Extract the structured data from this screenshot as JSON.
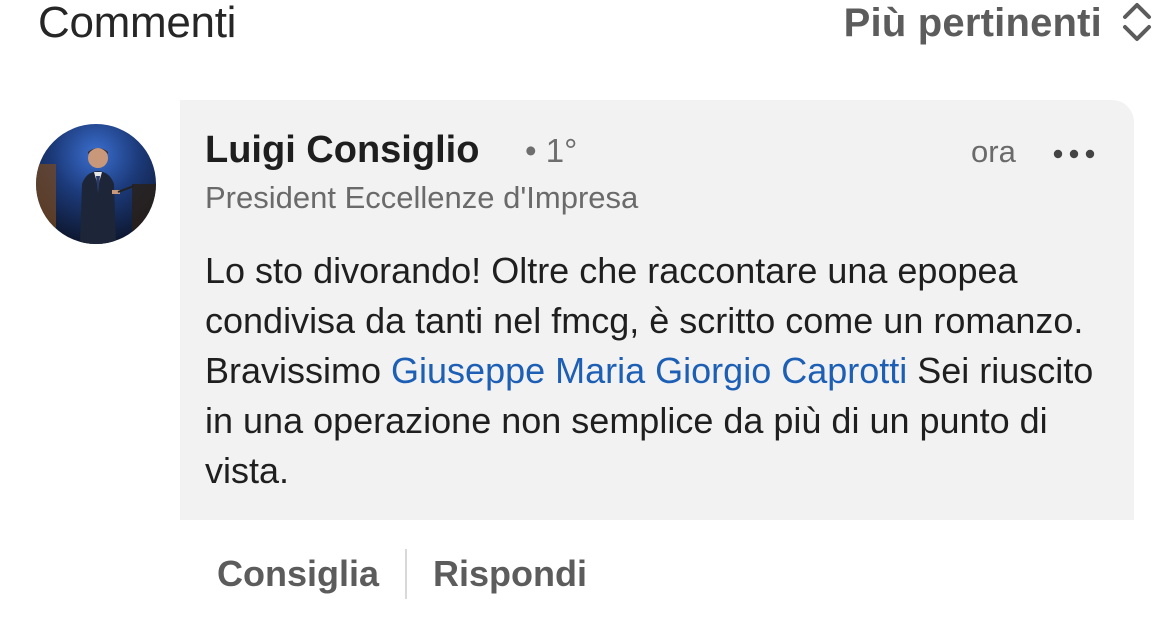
{
  "header": {
    "title": "Commenti",
    "sort_label": "Più pertinenti",
    "sort_icon": "chevron-up-down-icon"
  },
  "comment": {
    "author_name": "Luigi Consiglio",
    "connection_degree": "• 1°",
    "author_headline": "President Eccellenze d'Impresa",
    "timestamp": "ora",
    "more_icon": "ellipsis-icon",
    "text_part1": "Lo sto divorando! Oltre che raccontare una epopea condivisa da tanti nel fmcg, è scritto come un romanzo. Bravissimo ",
    "mention": "Giuseppe Maria Giorgio Caprotti",
    "text_part2": " Sei riuscito in una operazione non semplice da più di un punto di vista."
  },
  "actions": {
    "like_label": "Consiglia",
    "reply_label": "Rispondi"
  },
  "colors": {
    "bubble_background": "#f2f2f2",
    "mention": "#1d5fb5",
    "secondary_text": "#6a6a6a"
  }
}
